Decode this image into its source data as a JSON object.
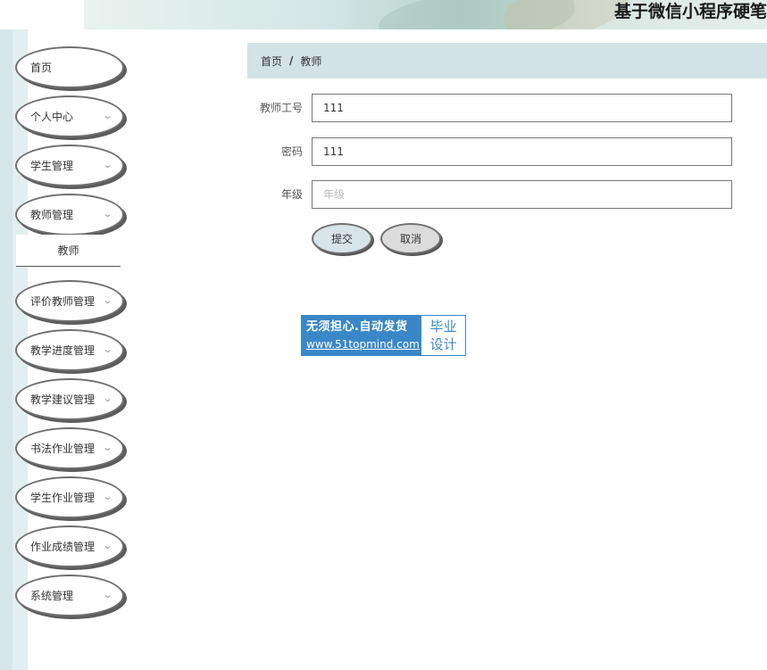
{
  "header": {
    "title": "基于微信小程序硬笔"
  },
  "sidebar": {
    "items": [
      {
        "label": "首页",
        "has_chevron": false
      },
      {
        "label": "个人中心",
        "has_chevron": true
      },
      {
        "label": "学生管理",
        "has_chevron": true
      },
      {
        "label": "教师管理",
        "has_chevron": true
      },
      {
        "label": "评价教师管理",
        "has_chevron": true
      },
      {
        "label": "教学进度管理",
        "has_chevron": true
      },
      {
        "label": "教学建议管理",
        "has_chevron": true
      },
      {
        "label": "书法作业管理",
        "has_chevron": true
      },
      {
        "label": "学生作业管理",
        "has_chevron": true
      },
      {
        "label": "作业成绩管理",
        "has_chevron": true
      },
      {
        "label": "系统管理",
        "has_chevron": true
      }
    ],
    "submenu_label": "教师",
    "chevron_icon": "chevron-down-icon"
  },
  "breadcrumb": {
    "home": "首页",
    "separator": "/",
    "current": "教师"
  },
  "form": {
    "fields": [
      {
        "label": "教师工号",
        "value": "111",
        "placeholder": ""
      },
      {
        "label": "密码",
        "value": "111",
        "placeholder": ""
      },
      {
        "label": "年级",
        "value": "",
        "placeholder": "年级"
      }
    ],
    "submit_label": "提交",
    "cancel_label": "取消"
  },
  "watermark": {
    "line1": "无须担心.自动发货",
    "line2": "www.51topmind.com",
    "right_line1": "毕业",
    "right_line2": "设计"
  },
  "colors": {
    "accent": "#d3e2e6",
    "watermark_blue": "#3a87c8"
  }
}
